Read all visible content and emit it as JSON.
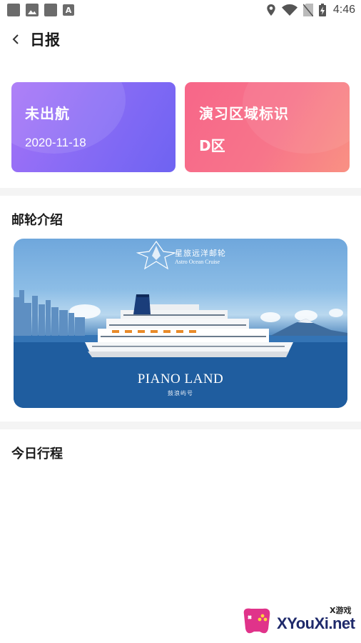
{
  "status_bar": {
    "time": "4:46",
    "left_icons": [
      "gallery-icon",
      "image-icon",
      "stop-icon",
      "a-letter-icon"
    ],
    "right_icons": [
      "location-icon",
      "wifi-icon",
      "no-sim-icon",
      "battery-charging-icon"
    ]
  },
  "header": {
    "title": "日报"
  },
  "cards": {
    "left": {
      "title": "未出航",
      "date": "2020-11-18",
      "color_from": "#a672f7",
      "color_to": "#6e63f2"
    },
    "right": {
      "title": "演习区域标识",
      "value": "D区",
      "color_from": "#f76689",
      "color_to": "#f99183"
    }
  },
  "cruise_section": {
    "title": "邮轮介绍",
    "banner": {
      "brand_cn": "星旅远洋邮轮",
      "brand_en": "Astro Ocean Cruise",
      "ship_name": "PIANO LAND",
      "ship_name_cn": "鼓浪屿号"
    }
  },
  "schedule_section": {
    "title": "今日行程"
  },
  "watermark": {
    "top": "X游戏",
    "text": "XYouXi.net"
  }
}
